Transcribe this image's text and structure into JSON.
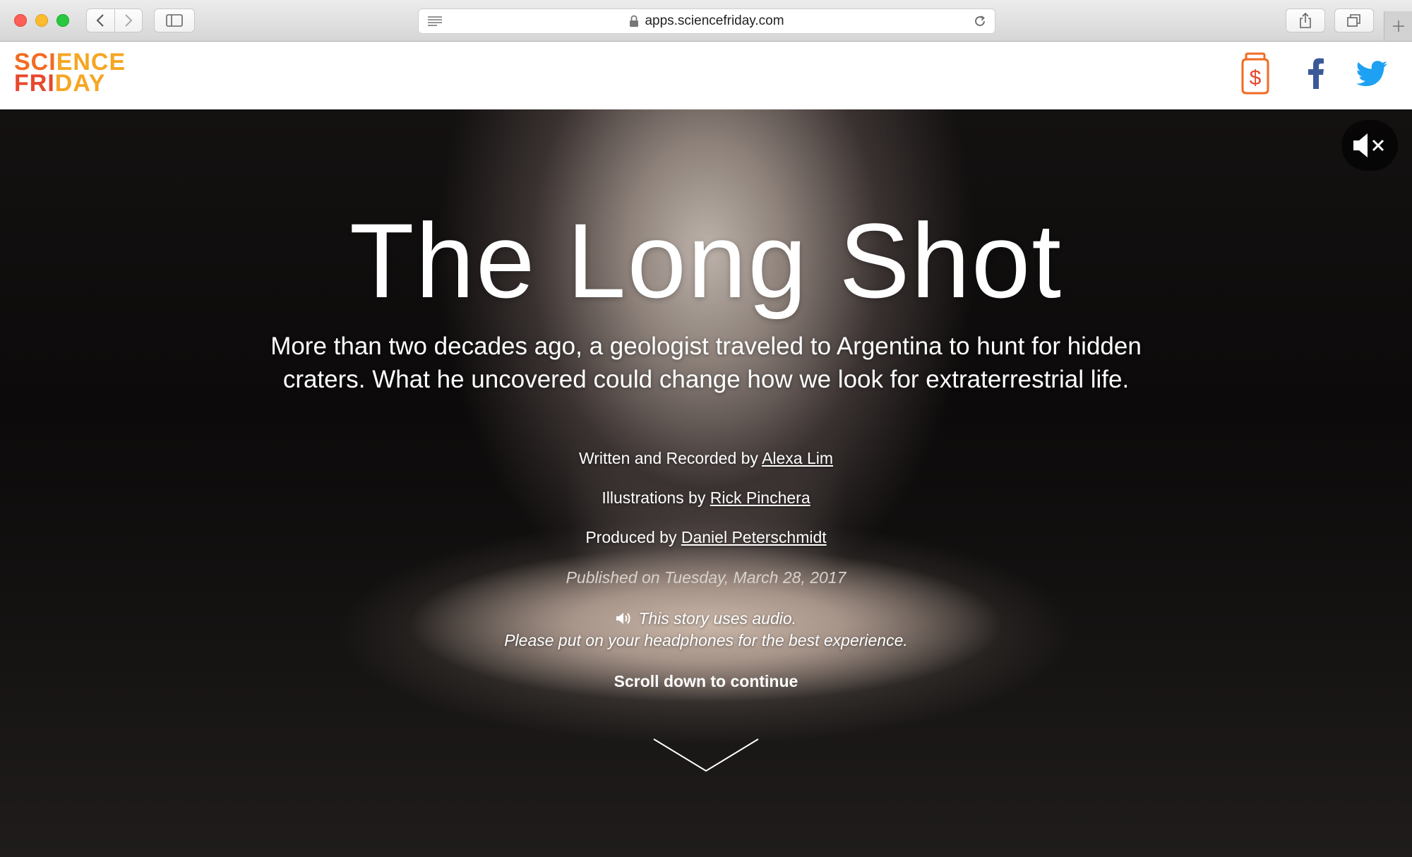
{
  "browser": {
    "url": "apps.sciencefriday.com"
  },
  "site": {
    "logo_line1_a": "SCI",
    "logo_line1_b": "ENCE",
    "logo_line2_a": "FRI",
    "logo_line2_b": "DAY",
    "colors": {
      "orange": "#f26b21",
      "red": "#e8472b",
      "yellow": "#f5a623",
      "facebook": "#3b5998",
      "twitter": "#1da1f2"
    }
  },
  "hero": {
    "title": "The Long Shot",
    "subtitle": "More than two decades ago, a geologist traveled to Argentina to hunt for hidden craters. What he uncovered could change how we look for extraterrestrial life.",
    "credits": [
      {
        "prefix": "Written and Recorded by",
        "name": "Alexa Lim"
      },
      {
        "prefix": "Illustrations by",
        "name": "Rick Pinchera"
      },
      {
        "prefix": "Produced by",
        "name": "Daniel Peterschmidt"
      }
    ],
    "published": "Published on Tuesday, March 28, 2017",
    "audio_line1": "This story uses audio.",
    "audio_line2": "Please put on your headphones for the best experience.",
    "scroll_prompt": "Scroll down to continue"
  }
}
